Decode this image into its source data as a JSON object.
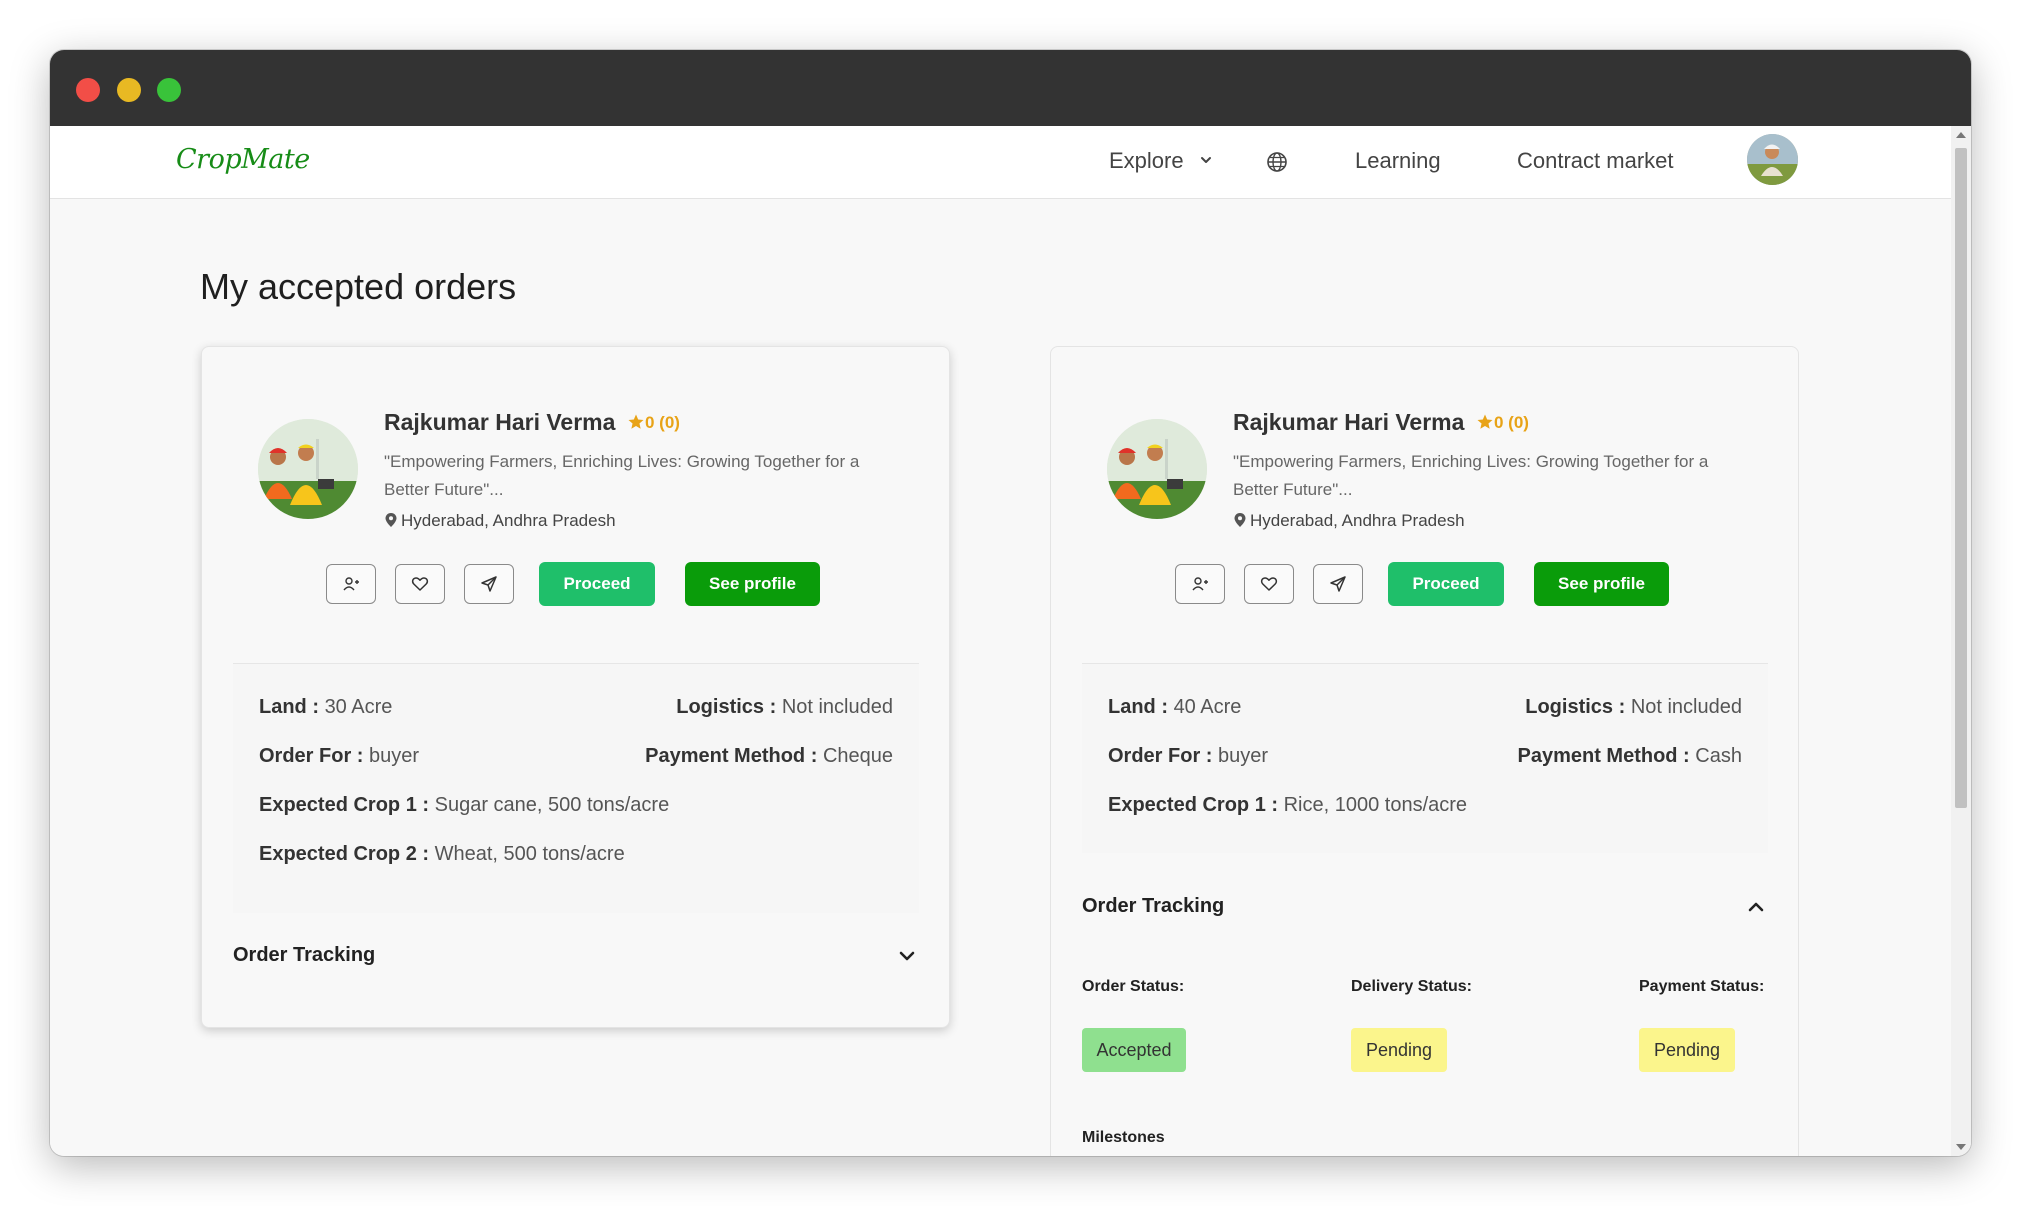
{
  "brand": {
    "name": "CropMate",
    "color": "#178c17"
  },
  "nav": {
    "explore": "Explore",
    "learning": "Learning",
    "contract_market": "Contract market"
  },
  "page": {
    "title": "My accepted orders"
  },
  "labels": {
    "proceed": "Proceed",
    "see_profile": "See profile",
    "land": "Land :",
    "logistics": "Logistics :",
    "order_for": "Order For :",
    "payment_method": "Payment Method :",
    "expected_crop_1": "Expected Crop 1 :",
    "expected_crop_2": "Expected Crop 2 :",
    "order_tracking": "Order Tracking",
    "order_status": "Order Status:",
    "delivery_status": "Delivery Status:",
    "payment_status": "Payment Status:",
    "milestones": "Milestones"
  },
  "orders": [
    {
      "name": "Rajkumar Hari Verma",
      "rating": "0 (0)",
      "quote": "\"Empowering Farmers, Enriching Lives: Growing Together for a Better Future\"...",
      "location": "Hyderabad, Andhra Pradesh",
      "land": "30 Acre",
      "logistics": "Not included",
      "order_for": "buyer",
      "payment_method": "Cheque",
      "expected_crop_1": "Sugar cane, 500 tons/acre",
      "expected_crop_2": "Wheat, 500 tons/acre",
      "tracking_expanded": false
    },
    {
      "name": "Rajkumar Hari Verma",
      "rating": "0 (0)",
      "quote": "\"Empowering Farmers, Enriching Lives: Growing Together for a Better Future\"...",
      "location": "Hyderabad, Andhra Pradesh",
      "land": "40 Acre",
      "logistics": "Not included",
      "order_for": "buyer",
      "payment_method": "Cash",
      "expected_crop_1": "Rice, 1000 tons/acre",
      "tracking_expanded": true,
      "order_status": "Accepted",
      "delivery_status": "Pending",
      "payment_status": "Pending"
    }
  ],
  "colors": {
    "proceed": "#1fbf6a",
    "see_profile": "#0a9c0a",
    "rating": "#e8a317",
    "accepted_badge": "#8fe08f",
    "pending_badge": "#fbf58c"
  },
  "icons": [
    "chevron-down-icon",
    "globe-icon",
    "star-icon",
    "location-pin-icon",
    "add-user-icon",
    "heart-icon",
    "send-icon",
    "chevron-up-icon"
  ]
}
